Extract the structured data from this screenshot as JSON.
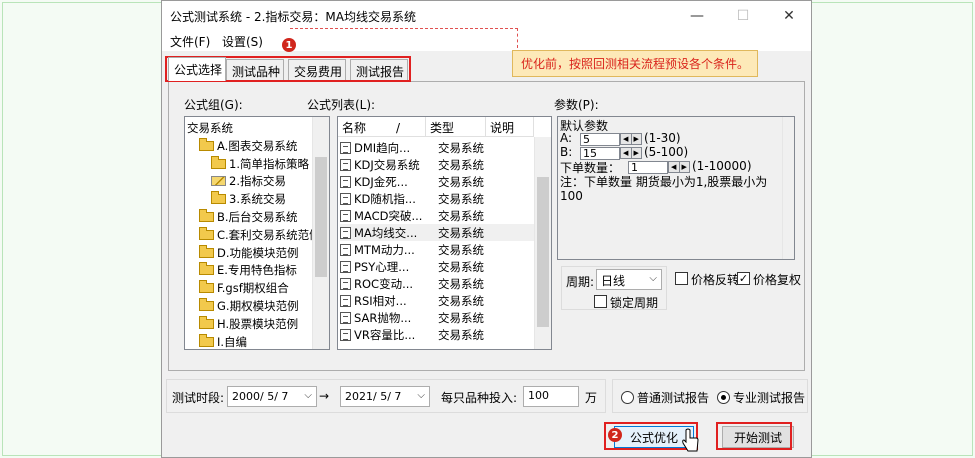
{
  "window": {
    "title": "公式测试系统 - 2.指标交易：MA均线交易系统",
    "minimize": "—",
    "maximize": "☐",
    "close": "✕"
  },
  "menu": {
    "file": "文件(F)",
    "settings": "设置(S)"
  },
  "tabs": [
    "公式选择",
    "测试品种",
    "交易费用",
    "测试报告"
  ],
  "callout": {
    "text": "优化前，按照回测相关流程预设各个条件。",
    "marker": "1"
  },
  "formula_group": {
    "label": "公式组(G):",
    "items": [
      {
        "text": "交易系统",
        "indent": 0,
        "icon": "none"
      },
      {
        "text": "A.图表交易系统",
        "indent": 1,
        "icon": "folder"
      },
      {
        "text": "1.简单指标策略",
        "indent": 2,
        "icon": "folder"
      },
      {
        "text": "2.指标交易",
        "indent": 2,
        "icon": "pencil"
      },
      {
        "text": "3.系统交易",
        "indent": 2,
        "icon": "folder"
      },
      {
        "text": "B.后台交易系统",
        "indent": 1,
        "icon": "folder"
      },
      {
        "text": "C.套利交易系统范例",
        "indent": 1,
        "icon": "folder"
      },
      {
        "text": "D.功能模块范例",
        "indent": 1,
        "icon": "folder"
      },
      {
        "text": "E.专用特色指标",
        "indent": 1,
        "icon": "folder"
      },
      {
        "text": "F.gsf期权组合",
        "indent": 1,
        "icon": "folder"
      },
      {
        "text": "G.期权模块范例",
        "indent": 1,
        "icon": "folder"
      },
      {
        "text": "H.股票模块范例",
        "indent": 1,
        "icon": "folder"
      },
      {
        "text": "I.自编",
        "indent": 1,
        "icon": "folder"
      }
    ]
  },
  "formula_list": {
    "label": "公式列表(L):",
    "headers": {
      "name": "名称",
      "sort": "/",
      "type": "类型",
      "desc": "说明"
    },
    "rows": [
      {
        "name": "DMI趋向...",
        "type": "交易系统"
      },
      {
        "name": "KDJ交易系统",
        "type": "交易系统"
      },
      {
        "name": "KDJ金死...",
        "type": "交易系统"
      },
      {
        "name": "KD随机指...",
        "type": "交易系统"
      },
      {
        "name": "MACD突破...",
        "type": "交易系统"
      },
      {
        "name": "MA均线交...",
        "type": "交易系统"
      },
      {
        "name": "MTM动力...",
        "type": "交易系统"
      },
      {
        "name": "PSY心理...",
        "type": "交易系统"
      },
      {
        "name": "ROC变动...",
        "type": "交易系统"
      },
      {
        "name": "RSI相对...",
        "type": "交易系统"
      },
      {
        "name": "SAR抛物...",
        "type": "交易系统"
      },
      {
        "name": "VR容量比...",
        "type": "交易系统"
      }
    ]
  },
  "params": {
    "label": "参数(P):",
    "default": "默认参数",
    "a_label": "A:",
    "a_value": "5",
    "a_range": "(1-30)",
    "b_label": "B:",
    "b_value": "15",
    "b_range": "(5-100)",
    "qty_label": "下单数量：",
    "qty_value": "1",
    "qty_range": "(1-10000)",
    "note": "注：下单数量 期货最小为1,股票最小为100"
  },
  "period": {
    "label": "周期:",
    "value": "日线",
    "lock": "锁定周期"
  },
  "options": {
    "reverse": "价格反转",
    "adjust": "价格复权"
  },
  "bottom": {
    "period_label": "测试时段:",
    "start_date": "2000/ 5/ 7",
    "arrow": "→",
    "end_date": "2021/ 5/ 7",
    "invest_label": "每只品种投入:",
    "invest_value": "100",
    "unit": "万",
    "report_normal": "普通测试报告",
    "report_pro": "专业测试报告"
  },
  "buttons": {
    "optimize": "公式优化",
    "optimize_marker": "2",
    "start": "开始测试"
  }
}
